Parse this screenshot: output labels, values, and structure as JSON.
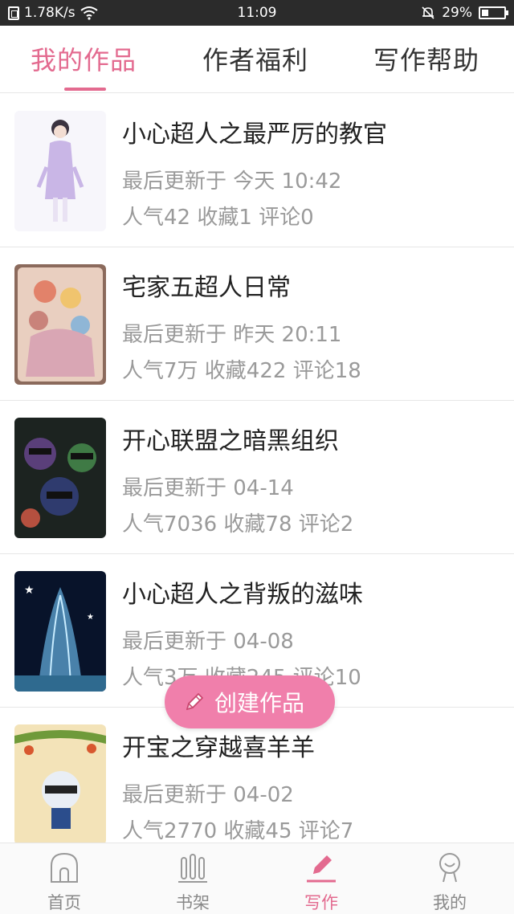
{
  "status_bar": {
    "speed": "1.78K/s",
    "time": "11:09",
    "battery": "29%"
  },
  "tabs": [
    {
      "label": "我的作品",
      "active": true
    },
    {
      "label": "作者福利",
      "active": false
    },
    {
      "label": "写作帮助",
      "active": false
    }
  ],
  "works": [
    {
      "title": "小心超人之最严厉的教官",
      "updated": "最后更新于 今天 10:42",
      "stats": "人气42 收藏1 评论0"
    },
    {
      "title": "宅家五超人日常",
      "updated": "最后更新于 昨天 20:11",
      "stats": "人气7万 收藏422 评论18"
    },
    {
      "title": "开心联盟之暗黑组织",
      "updated": "最后更新于 04-14",
      "stats": "人气7036 收藏78 评论2"
    },
    {
      "title": "小心超人之背叛的滋味",
      "updated": "最后更新于 04-08",
      "stats": "人气3万 收藏245 评论10"
    },
    {
      "title": "开宝之穿越喜羊羊",
      "updated": "最后更新于 04-02",
      "stats": "人气2770 收藏45 评论7"
    }
  ],
  "create_button": {
    "label": "创建作品",
    "icon": "pencil-icon"
  },
  "bottom_nav": [
    {
      "label": "首页",
      "icon": "home-icon",
      "active": false
    },
    {
      "label": "书架",
      "icon": "bookshelf-icon",
      "active": false
    },
    {
      "label": "写作",
      "icon": "pencil-icon",
      "active": true
    },
    {
      "label": "我的",
      "icon": "profile-icon",
      "active": false
    }
  ],
  "colors": {
    "accent": "#e36a8f",
    "button": "#f07fab",
    "status_bar": "#2b2b2b",
    "muted_text": "#9a9a9a"
  }
}
